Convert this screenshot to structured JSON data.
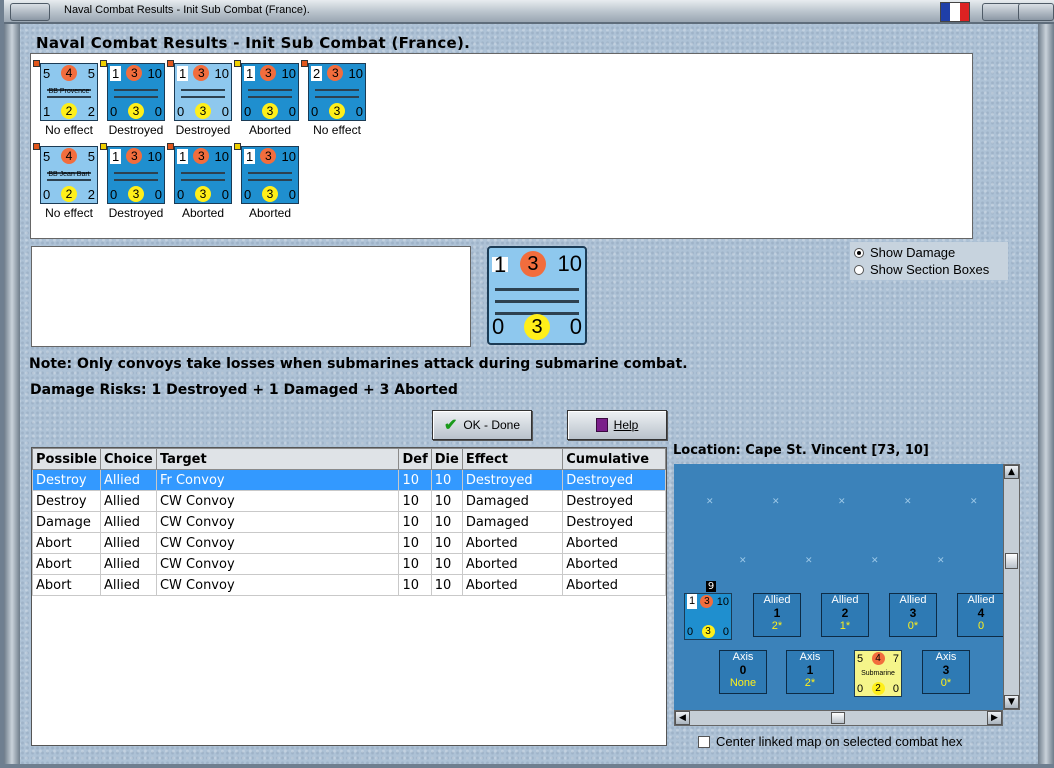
{
  "window": {
    "title": "Naval Combat Results - Init Sub Combat (France)."
  },
  "heading": "Naval Combat Results - Init Sub Combat (France).",
  "results": {
    "row1": [
      {
        "tl": "5",
        "mid": "4",
        "tr": "5",
        "bl": "1",
        "bmid": "2",
        "br": "2",
        "name": "BB Provence",
        "style": "light",
        "effect": "No effect"
      },
      {
        "tl": "1",
        "mid": "3",
        "tr": "10",
        "bl": "0",
        "bmid": "3",
        "br": "0",
        "name": "",
        "style": "dark",
        "effect": "Destroyed"
      },
      {
        "tl": "1",
        "mid": "3",
        "tr": "10",
        "bl": "0",
        "bmid": "3",
        "br": "0",
        "name": "",
        "style": "light",
        "effect": "Destroyed"
      },
      {
        "tl": "1",
        "mid": "3",
        "tr": "10",
        "bl": "0",
        "bmid": "3",
        "br": "0",
        "name": "",
        "style": "dark",
        "effect": "Aborted"
      },
      {
        "tl": "2",
        "mid": "3",
        "tr": "10",
        "bl": "0",
        "bmid": "3",
        "br": "0",
        "name": "",
        "style": "dark",
        "effect": "No effect"
      }
    ],
    "row2": [
      {
        "tl": "5",
        "mid": "4",
        "tr": "5",
        "bl": "0",
        "bmid": "2",
        "br": "2",
        "name": "BB Jean Bart",
        "style": "light",
        "effect": "No effect"
      },
      {
        "tl": "1",
        "mid": "3",
        "tr": "10",
        "bl": "0",
        "bmid": "3",
        "br": "0",
        "name": "",
        "style": "dark",
        "effect": "Destroyed"
      },
      {
        "tl": "1",
        "mid": "3",
        "tr": "10",
        "bl": "0",
        "bmid": "3",
        "br": "0",
        "name": "",
        "style": "dark",
        "effect": "Aborted"
      },
      {
        "tl": "1",
        "mid": "3",
        "tr": "10",
        "bl": "0",
        "bmid": "3",
        "br": "0",
        "name": "",
        "style": "dark",
        "effect": "Aborted"
      }
    ]
  },
  "selected_unit": {
    "tl": "1",
    "mid": "3",
    "tr": "10",
    "bl": "0",
    "bmid": "3",
    "br": "0"
  },
  "options": {
    "show_damage": "Show Damage",
    "show_section_boxes": "Show Section Boxes"
  },
  "note": "Note: Only convoys take losses when submarines attack during submarine combat.",
  "risks": "Damage Risks:  1 Destroyed + 1 Damaged + 3 Aborted",
  "buttons": {
    "ok": "OK - Done",
    "help": "Help"
  },
  "table": {
    "headers": [
      "Possible",
      "Choice",
      "Target",
      "Def",
      "Die",
      "Effect",
      "Cumulative"
    ],
    "rows": [
      [
        "Destroy",
        "Allied",
        "Fr Convoy",
        "10",
        "10",
        "Destroyed",
        "Destroyed"
      ],
      [
        "Destroy",
        "Allied",
        "CW Convoy",
        "10",
        "10",
        "Damaged",
        "Destroyed"
      ],
      [
        "Damage",
        "Allied",
        "CW Convoy",
        "10",
        "10",
        "Damaged",
        "Destroyed"
      ],
      [
        "Abort",
        "Allied",
        "CW Convoy",
        "10",
        "10",
        "Aborted",
        "Aborted"
      ],
      [
        "Abort",
        "Allied",
        "CW Convoy",
        "10",
        "10",
        "Aborted",
        "Aborted"
      ],
      [
        "Abort",
        "Allied",
        "CW Convoy",
        "10",
        "10",
        "Aborted",
        "Aborted"
      ]
    ]
  },
  "location": "Location:  Cape St. Vincent [73, 10]",
  "map": {
    "stack_count": "9",
    "stack_unit": {
      "tl": "1",
      "mid": "3",
      "tr": "10",
      "bl": "0",
      "bmid": "3",
      "br": "0"
    },
    "allied_boxes": [
      {
        "label": "Allied",
        "num": "1",
        "val": "2*"
      },
      {
        "label": "Allied",
        "num": "2",
        "val": "1*"
      },
      {
        "label": "Allied",
        "num": "3",
        "val": "0*"
      },
      {
        "label": "Allied",
        "num": "4",
        "val": "0"
      }
    ],
    "axis_boxes": [
      {
        "label": "Axis",
        "num": "0",
        "val": "None"
      },
      {
        "label": "Axis",
        "num": "1",
        "val": "2*"
      },
      {
        "label": "Axis",
        "num": "3",
        "val": "0*"
      }
    ],
    "sub_unit": {
      "tl": "5",
      "mid": "4",
      "tr": "7",
      "name": "Submarine",
      "bl": "0",
      "bmid": "2",
      "br": "0"
    }
  },
  "center_map_label": "Center linked map on selected combat hex",
  "colors": {
    "counter_light": "#8ec8ee",
    "counter_dark": "#1f8fcf",
    "selected_row": "#3399ff",
    "attack_dot": "#f26d3d",
    "defense_dot": "#ffef1a"
  }
}
